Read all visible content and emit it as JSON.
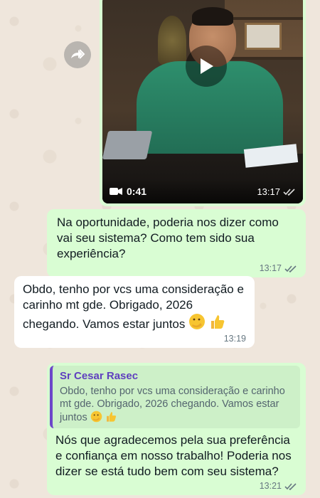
{
  "video_message": {
    "duration": "0:41",
    "time": "13:17"
  },
  "messages": [
    {
      "direction": "outgoing",
      "text": "Na oportunidade, poderia nos dizer como vai seu sistema? Como tem sido sua experiência?",
      "time": "13:17",
      "status": "read"
    },
    {
      "direction": "incoming",
      "text": "Obdo, tenho por vcs uma consideração e carinho mt gde. Obrigado, 2026 chegando. Vamos estar juntos",
      "emoji": [
        "smiling-face-with-hand-over-mouth",
        "thumbs-up"
      ],
      "time": "13:19"
    },
    {
      "direction": "outgoing",
      "reply_to": {
        "author": "Sr Cesar Rasec",
        "text": "Obdo, tenho por vcs uma consideração e carinho mt gde. Obrigado, 2026 chegando. Vamos estar juntos"
      },
      "text": "Nós que agradecemos pela sua preferência e confiança em nosso trabalho! Poderia nos dizer se está tudo bem com seu sistema?",
      "time": "13:21",
      "status": "read"
    }
  ],
  "colors": {
    "outgoing_bubble": "#d9fdd3",
    "incoming_bubble": "#ffffff",
    "wallpaper": "#efe6dc",
    "quote_accent": "#6c47c9",
    "read_ticks": "#667781"
  }
}
